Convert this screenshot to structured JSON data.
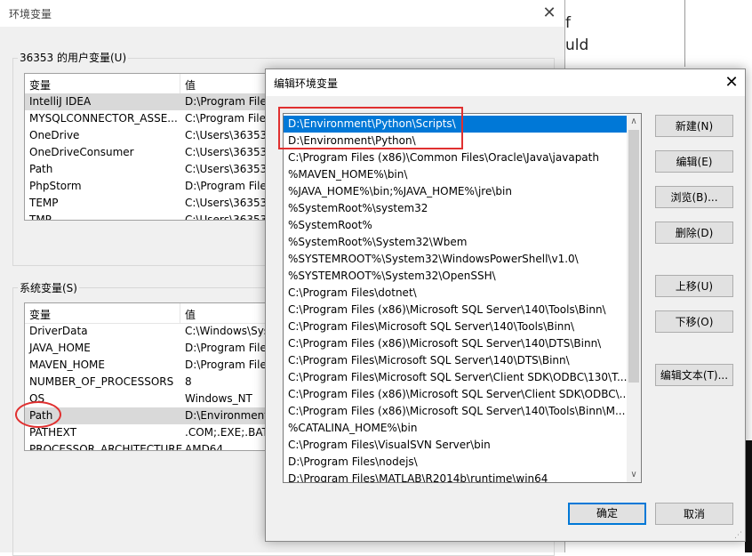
{
  "background": {
    "text_lines": [
      "f",
      "uld"
    ]
  },
  "back_dialog": {
    "title": "环境变量",
    "close": "✕",
    "user_group_label": "36353 的用户变量(U)",
    "system_group_label": "系统变量(S)",
    "columns": {
      "name": "变量",
      "value": "值"
    },
    "user_vars": [
      {
        "name": "IntelliJ IDEA",
        "value": "D:\\Program Files"
      },
      {
        "name": "MYSQLCONNECTOR_ASSE...",
        "value": "C:\\Program Files"
      },
      {
        "name": "OneDrive",
        "value": "C:\\Users\\36353\\"
      },
      {
        "name": "OneDriveConsumer",
        "value": "C:\\Users\\36353\\"
      },
      {
        "name": "Path",
        "value": "C:\\Users\\36353\\"
      },
      {
        "name": "PhpStorm",
        "value": "D:\\Program Files"
      },
      {
        "name": "TEMP",
        "value": "C:\\Users\\36353\\"
      },
      {
        "name": "TMP",
        "value": "C:\\Users\\36353\\"
      }
    ],
    "system_vars": [
      {
        "name": "DriverData",
        "value": "C:\\Windows\\Sys"
      },
      {
        "name": "JAVA_HOME",
        "value": "D:\\Program Files"
      },
      {
        "name": "MAVEN_HOME",
        "value": "D:\\Program Files"
      },
      {
        "name": "NUMBER_OF_PROCESSORS",
        "value": "8"
      },
      {
        "name": "OS",
        "value": "Windows_NT"
      },
      {
        "name": "Path",
        "value": "D:\\Environment\\"
      },
      {
        "name": "PATHEXT",
        "value": ".COM;.EXE;.BAT;"
      },
      {
        "name": "PROCESSOR_ARCHITECTURE",
        "value": "AMD64"
      }
    ]
  },
  "edit_dialog": {
    "title": "编辑环境变量",
    "close": "✕",
    "paths": [
      "D:\\Environment\\Python\\Scripts\\",
      "D:\\Environment\\Python\\",
      "C:\\Program Files (x86)\\Common Files\\Oracle\\Java\\javapath",
      "%MAVEN_HOME%\\bin\\",
      "%JAVA_HOME%\\bin;%JAVA_HOME%\\jre\\bin",
      "%SystemRoot%\\system32",
      "%SystemRoot%",
      "%SystemRoot%\\System32\\Wbem",
      "%SYSTEMROOT%\\System32\\WindowsPowerShell\\v1.0\\",
      "%SYSTEMROOT%\\System32\\OpenSSH\\",
      "C:\\Program Files\\dotnet\\",
      "C:\\Program Files (x86)\\Microsoft SQL Server\\140\\Tools\\Binn\\",
      "C:\\Program Files\\Microsoft SQL Server\\140\\Tools\\Binn\\",
      "C:\\Program Files (x86)\\Microsoft SQL Server\\140\\DTS\\Binn\\",
      "C:\\Program Files\\Microsoft SQL Server\\140\\DTS\\Binn\\",
      "C:\\Program Files\\Microsoft SQL Server\\Client SDK\\ODBC\\130\\T...",
      "C:\\Program Files (x86)\\Microsoft SQL Server\\Client SDK\\ODBC\\...",
      "C:\\Program Files (x86)\\Microsoft SQL Server\\140\\Tools\\Binn\\M...",
      "%CATALINA_HOME%\\bin",
      "C:\\Program Files\\VisualSVN Server\\bin",
      "D:\\Program Files\\nodejs\\",
      "D:\\Program Files\\MATLAB\\R2014b\\runtime\\win64"
    ],
    "buttons": {
      "new": "新建(N)",
      "edit": "编辑(E)",
      "browse": "浏览(B)...",
      "delete": "删除(D)",
      "move_up": "上移(U)",
      "move_down": "下移(O)",
      "edit_text": "编辑文本(T)...",
      "ok": "确定",
      "cancel": "取消"
    },
    "scroll_up": "∧",
    "scroll_down": "∨"
  },
  "colors": {
    "annotation": "#e03030",
    "selection": "#0078d7"
  }
}
